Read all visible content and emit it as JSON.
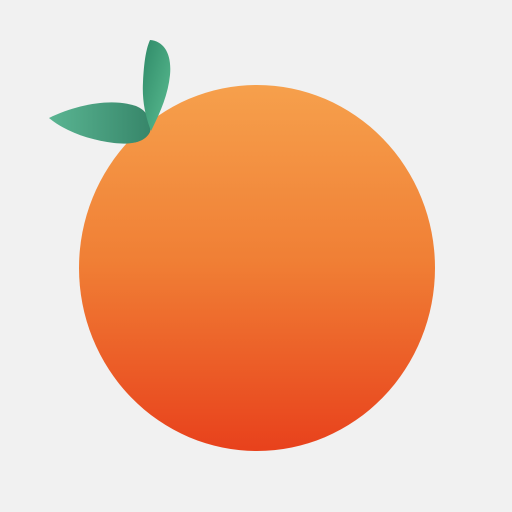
{
  "illustration": {
    "subject": "orange",
    "icons": {
      "fruit": "orange-fruit-icon",
      "leaf_left": "leaf-icon",
      "leaf_top": "leaf-icon"
    },
    "colors": {
      "background": "#f1f1f1",
      "fruit_top": "#f6a04c",
      "fruit_mid": "#f07f35",
      "fruit_bottom": "#e8411c",
      "leaf_dark": "#2f8a68",
      "leaf_light": "#5bbd92",
      "leaf_left_dark": "#37866a",
      "leaf_left_light": "#5ab592"
    }
  }
}
